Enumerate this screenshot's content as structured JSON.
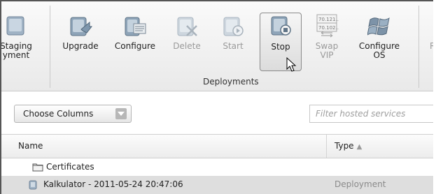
{
  "ribbon": {
    "buttons": [
      {
        "id": "staging",
        "label": "Staging\nyment",
        "disabled": false
      },
      {
        "id": "upgrade",
        "label": "Upgrade",
        "disabled": false
      },
      {
        "id": "configure",
        "label": "Configure",
        "disabled": false
      },
      {
        "id": "delete",
        "label": "Delete",
        "disabled": true
      },
      {
        "id": "start",
        "label": "Start",
        "disabled": true
      },
      {
        "id": "stop",
        "label": "Stop",
        "disabled": false
      },
      {
        "id": "swap",
        "label": "Swap\nVIP",
        "disabled": true
      },
      {
        "id": "configure_os",
        "label": "Configure\nOS",
        "disabled": false
      },
      {
        "id": "partial",
        "label": "R",
        "disabled": true
      }
    ],
    "swap_icon_text": [
      "70.121...",
      "70.102..."
    ],
    "group_label": "Deployments"
  },
  "toolbar": {
    "choose_columns_label": "Choose Columns",
    "filter_placeholder": "Filter hosted services"
  },
  "grid": {
    "columns": {
      "name": "Name",
      "type": "Type",
      "type_sort_glyph": "▲"
    },
    "rows": [
      {
        "name": "Certificates",
        "type": "",
        "icon": "folder-icon",
        "selected": false
      },
      {
        "name": "Kalkulator - 2011-05-24 20:47:06",
        "type": "Deployment",
        "icon": "deployment-icon",
        "selected": true
      }
    ]
  },
  "colors": {
    "ribbon_bg": "#efefef",
    "selected_row": "#dedede",
    "disabled_text": "#9a9a9a"
  }
}
